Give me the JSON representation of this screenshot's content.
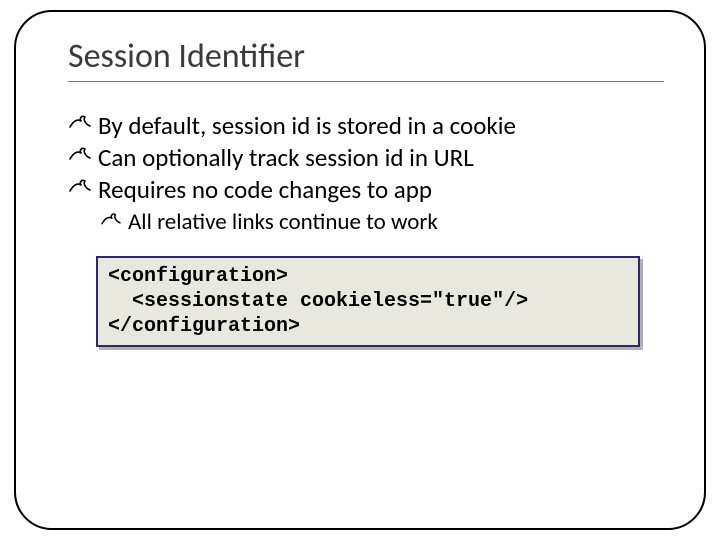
{
  "slide": {
    "title": "Session Identifier",
    "bullets": [
      "By default, session id is stored in a cookie",
      "Can optionally track session id in URL",
      "Requires no code changes to app"
    ],
    "subBullets": [
      "All relative links continue to work"
    ],
    "code": "<configuration>\n  <sessionstate cookieless=\"true\"/>\n</configuration>"
  }
}
